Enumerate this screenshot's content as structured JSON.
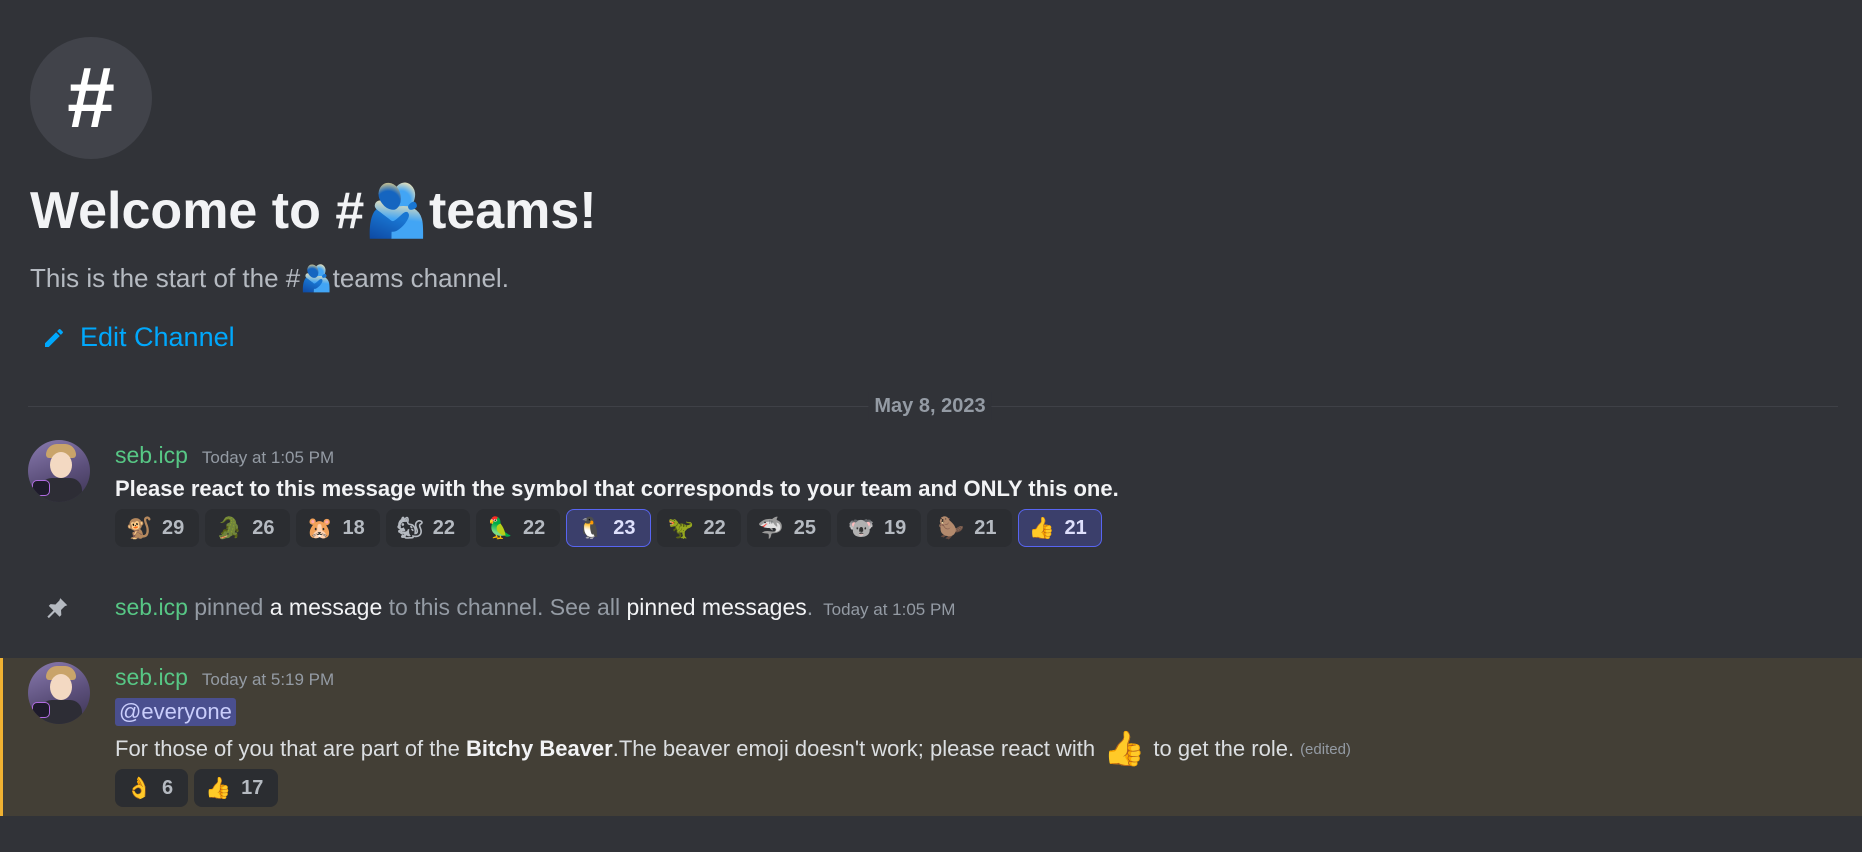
{
  "channel": {
    "icon": "#",
    "welcome_title": "Welcome to #🫂teams!",
    "description": "This is the start of the #🫂teams channel.",
    "edit_label": "Edit Channel"
  },
  "divider_date": "May 8, 2023",
  "messages": [
    {
      "author": "seb.icp",
      "timestamp": "Today at 1:05 PM",
      "content": "Please react to this message with the symbol that corresponds to your team and ONLY this one.",
      "reactions": [
        {
          "emoji": "🐒",
          "count": "29",
          "me": false
        },
        {
          "emoji": "🐊",
          "count": "26",
          "me": false
        },
        {
          "emoji": "🐹",
          "count": "18",
          "me": false
        },
        {
          "emoji": "🐿",
          "count": "22",
          "me": false
        },
        {
          "emoji": "🦜",
          "count": "22",
          "me": false
        },
        {
          "emoji": "🐧",
          "count": "23",
          "me": true
        },
        {
          "emoji": "🦖",
          "count": "22",
          "me": false
        },
        {
          "emoji": "🦈",
          "count": "25",
          "me": false
        },
        {
          "emoji": "🐨",
          "count": "19",
          "me": false
        },
        {
          "emoji": "🦫",
          "count": "21",
          "me": false
        },
        {
          "emoji": "👍",
          "count": "21",
          "me": true
        }
      ]
    },
    {
      "system": true,
      "author": "seb.icp",
      "text_pinned": " pinned ",
      "link_message": "a message",
      "text_mid": " to this channel. See all ",
      "link_pinned": "pinned messages",
      "text_end": ".",
      "timestamp": "Today at 1:05 PM"
    },
    {
      "author": "seb.icp",
      "timestamp": "Today at 5:19 PM",
      "mention": "@everyone",
      "content_prefix": "For those of you that are part of the ",
      "content_bold": "Bitchy Beaver",
      "content_mid": ".The beaver emoji doesn't work; please react with",
      "content_emoji": "👍",
      "content_suffix": "to get the role.",
      "edited": "(edited)",
      "reactions": [
        {
          "emoji": "👌",
          "count": "6",
          "me": false
        },
        {
          "emoji": "👍",
          "count": "17",
          "me": false
        }
      ]
    }
  ],
  "colors": {
    "background": "#313338",
    "author": "#57c785",
    "link": "#00a8fc",
    "highlight_bg": "#433f36",
    "highlight_border": "#f0b232",
    "reaction_me": "#5865f2"
  },
  "icons": {
    "edit": "pencil-icon",
    "pin": "pin-icon",
    "channel": "hash-icon"
  }
}
